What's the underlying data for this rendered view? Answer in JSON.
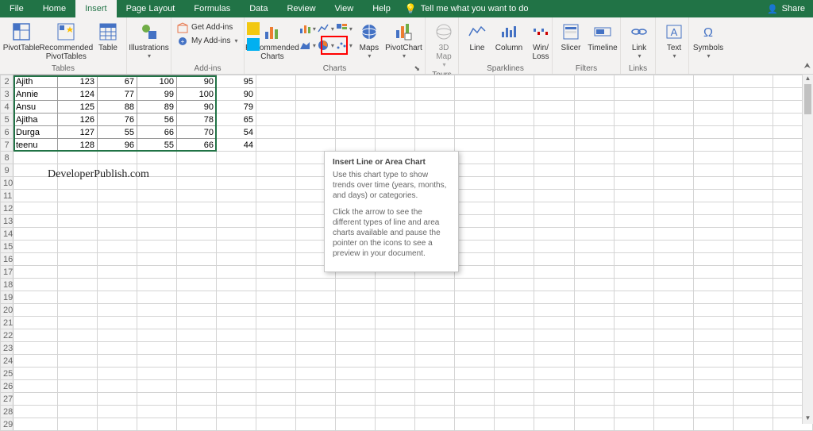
{
  "tabs": {
    "file": "File",
    "home": "Home",
    "insert": "Insert",
    "page_layout": "Page Layout",
    "formulas": "Formulas",
    "data": "Data",
    "review": "Review",
    "view": "View",
    "help": "Help",
    "tell_me": "Tell me what you want to do",
    "share": "Share"
  },
  "ribbon": {
    "tables": {
      "pivottable": "PivotTable",
      "recommended_pivottables": "Recommended\nPivotTables",
      "table": "Table",
      "label": "Tables"
    },
    "illustrations": {
      "btn": "Illustrations",
      "label": ""
    },
    "addins": {
      "get": "Get Add-ins",
      "my": "My Add-ins",
      "label": "Add-ins"
    },
    "charts": {
      "recommended": "Recommended\nCharts",
      "maps": "Maps",
      "pivotchart": "PivotChart",
      "label": "Charts"
    },
    "tours": {
      "map3d": "3D\nMap",
      "label": "Tours"
    },
    "sparklines": {
      "line": "Line",
      "column": "Column",
      "winloss": "Win/\nLoss",
      "label": "Sparklines"
    },
    "filters": {
      "slicer": "Slicer",
      "timeline": "Timeline",
      "label": "Filters"
    },
    "links": {
      "link": "Link",
      "label": "Links"
    },
    "text": {
      "btn": "Text",
      "label": ""
    },
    "symbols": {
      "btn": "Symbols",
      "label": ""
    }
  },
  "tooltip": {
    "title": "Insert Line or Area Chart",
    "p1": "Use this chart type to show trends over time (years, months, and days) or categories.",
    "p2": "Click the arrow to see the different types of line and area charts available and pause the pointer on the icons to see a preview in your document."
  },
  "sheet": {
    "rows": [
      {
        "n": 2,
        "a": "Ajith",
        "b": "123",
        "c": "67",
        "d": "100",
        "e": "90",
        "f": "95"
      },
      {
        "n": 3,
        "a": "Annie",
        "b": "124",
        "c": "77",
        "d": "99",
        "e": "100",
        "f": "90"
      },
      {
        "n": 4,
        "a": "Ansu",
        "b": "125",
        "c": "88",
        "d": "89",
        "e": "90",
        "f": "79"
      },
      {
        "n": 5,
        "a": "Ajitha",
        "b": "126",
        "c": "76",
        "d": "56",
        "e": "78",
        "f": "65"
      },
      {
        "n": 6,
        "a": "Durga",
        "b": "127",
        "c": "55",
        "d": "66",
        "e": "70",
        "f": "54"
      },
      {
        "n": 7,
        "a": "teenu",
        "b": "128",
        "c": "96",
        "d": "55",
        "e": "66",
        "f": "44"
      }
    ],
    "emptyStart": 8,
    "emptyEnd": 29
  },
  "watermark": "DeveloperPublish.com"
}
